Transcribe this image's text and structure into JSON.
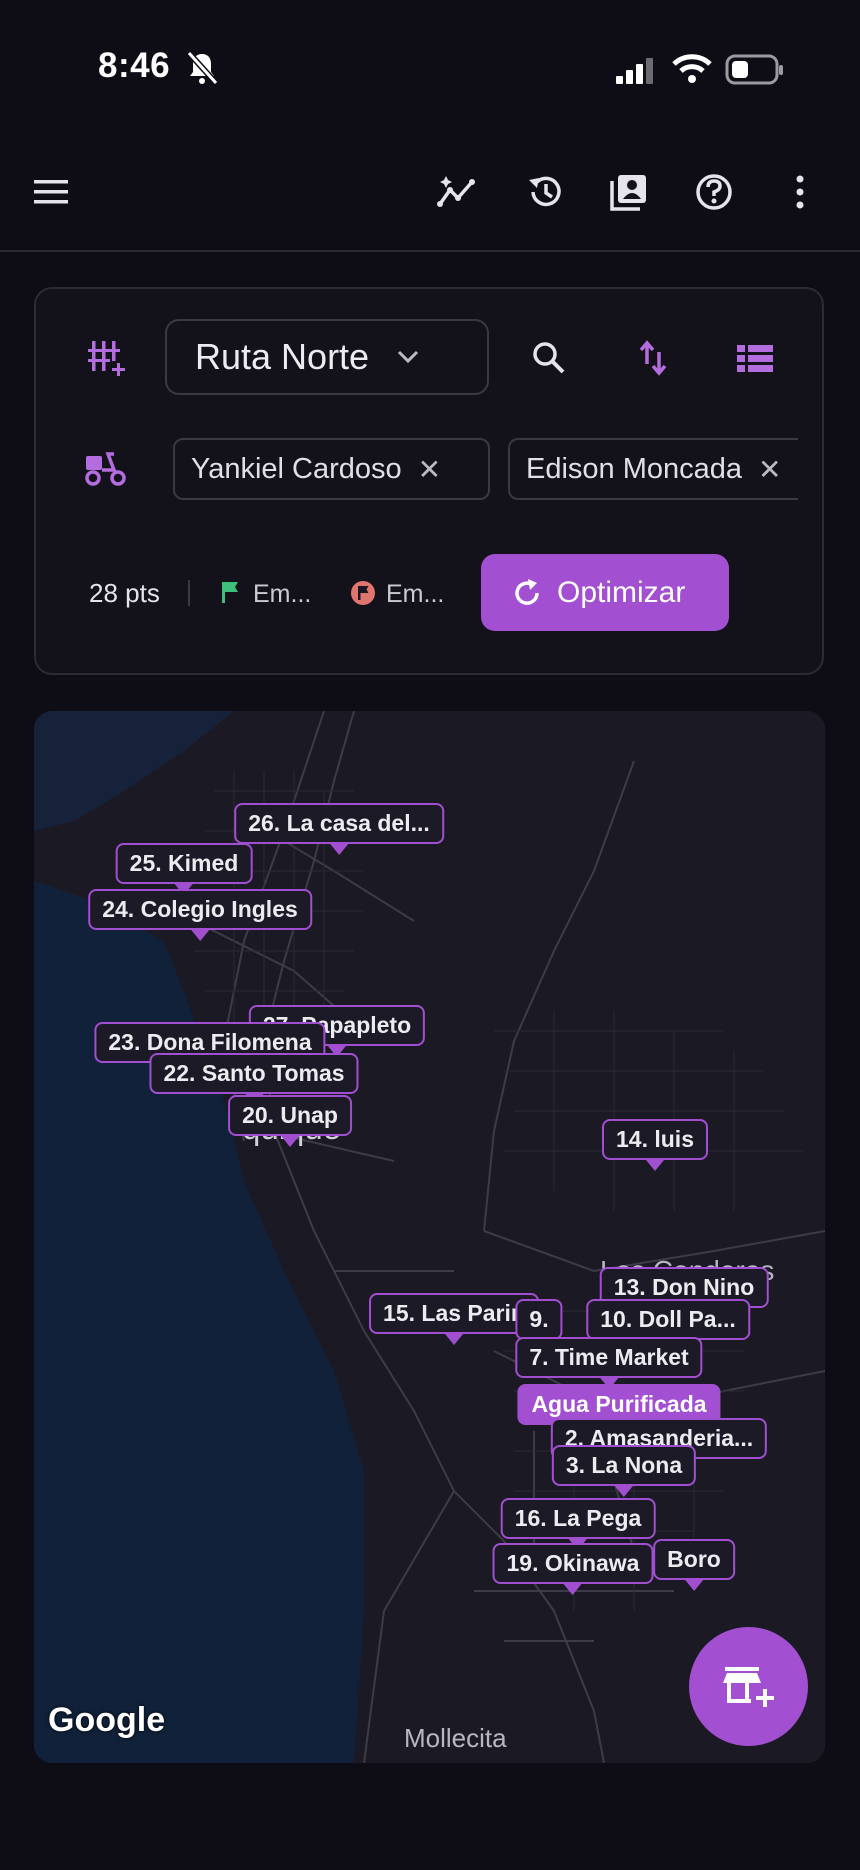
{
  "status_bar": {
    "time": "8:46"
  },
  "app_bar": {
    "icons": [
      "menu-icon",
      "analytics-icon",
      "history-icon",
      "contacts-icon",
      "help-icon",
      "more-vert-icon"
    ]
  },
  "filters": {
    "route": {
      "selected": "Ruta Norte"
    },
    "drivers": [
      {
        "name": "Yankiel Cardoso"
      },
      {
        "name": "Edison Moncada"
      }
    ],
    "points_count": "28 pts",
    "start_label": "Em...",
    "end_label": "Em...",
    "optimize_label": "Optimizar"
  },
  "map": {
    "places": [
      "quique",
      "Los Condores",
      "Mollecita"
    ],
    "logo": "Google",
    "stops": [
      {
        "label": "26. La casa del..."
      },
      {
        "label": "25. Kimed"
      },
      {
        "label": "24. Colegio Ingles"
      },
      {
        "label": "27. Papapleto"
      },
      {
        "label": "23. Dona Filomena"
      },
      {
        "label": "22. Santo Tomas"
      },
      {
        "label": "20. Unap"
      },
      {
        "label": "14. luis"
      },
      {
        "label": "13. Don Nino"
      },
      {
        "label": "15. Las Parin"
      },
      {
        "label": "9."
      },
      {
        "label": "10. Doll Pa..."
      },
      {
        "label": "7. Time Market"
      },
      {
        "label": "Agua Purificada"
      },
      {
        "label": "2. Amasanderia..."
      },
      {
        "label": "3. La Nona"
      },
      {
        "label": "16. La Pega"
      },
      {
        "label": "Boro"
      },
      {
        "label": "19. Okinawa"
      }
    ]
  },
  "colors": {
    "accent": "#a24fd1",
    "start_flag": "#3ec07a",
    "end_flag": "#e0756f"
  }
}
